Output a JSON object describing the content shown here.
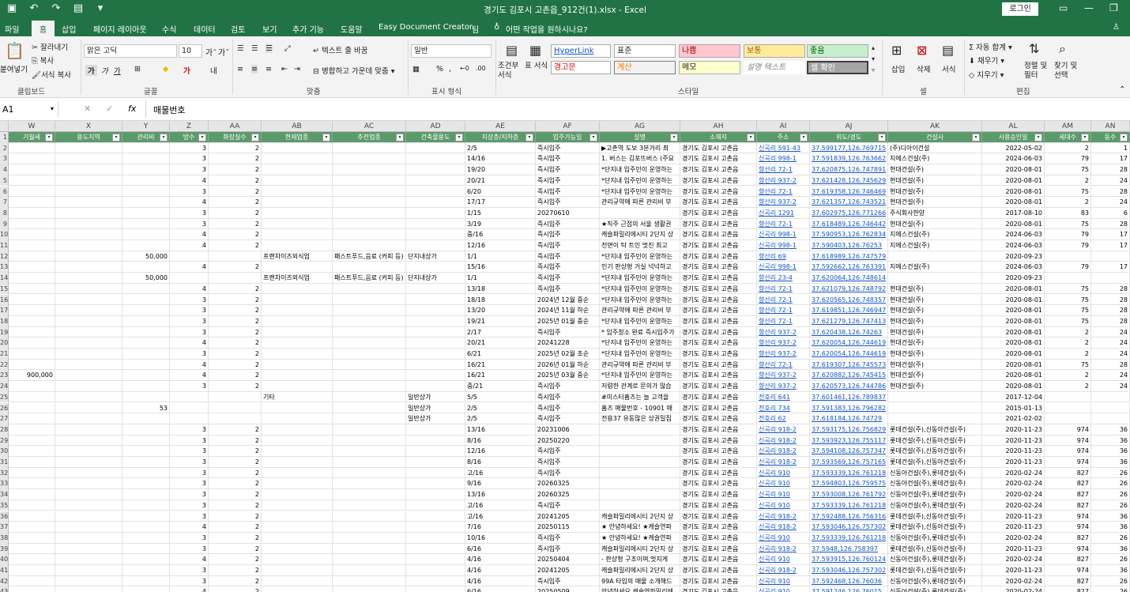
{
  "window": {
    "title": "경기도 김포시 고촌읍_912건(1).xlsx  -  Excel",
    "login": "로그인"
  },
  "tabs": [
    "파일",
    "홈",
    "삽입",
    "페이지 레이아웃",
    "수식",
    "데이터",
    "검토",
    "보기",
    "추가 기능",
    "도움말",
    "Easy Document Creator",
    "팀"
  ],
  "tell_me": "어떤 작업을 원하시나요?",
  "ribbon": {
    "paste": "붙여넣기",
    "cut": "잘라내기",
    "copy": "복사",
    "format_painter": "서식 복사",
    "clipboard": "클립보드",
    "font_name": "맑은 고딕",
    "font_size": "10",
    "font_group": "글꼴",
    "wrap": "텍스트 줄 바꿈",
    "merge": "병합하고 가운데 맞춤",
    "align_group": "맞춤",
    "number_format": "일반",
    "number_group": "표시 형식",
    "cond_format": "조건부 서식",
    "table_format": "표 서식",
    "styles": [
      "HyperLink",
      "표준",
      "나쁨",
      "보통",
      "좋음",
      "경고문",
      "계산",
      "메모",
      "설명 텍스트",
      "셀 확인"
    ],
    "styles_group": "스타일",
    "insert": "삽입",
    "delete": "삭제",
    "format": "서식",
    "cells_group": "셀",
    "autosum": "자동 합계",
    "fill": "채우기",
    "clear": "지우기",
    "sort": "정렬 및 필터",
    "find": "찾기 및 선택",
    "edit_group": "편집"
  },
  "formula_bar": {
    "cell": "A1",
    "value": "매물번호"
  },
  "columns": [
    {
      "letter": "W",
      "header": "기월세"
    },
    {
      "letter": "X",
      "header": "용도지역"
    },
    {
      "letter": "Y",
      "header": "관리비"
    },
    {
      "letter": "Z",
      "header": "방수"
    },
    {
      "letter": "AA",
      "header": "화장실수"
    },
    {
      "letter": "AB",
      "header": "현재업종"
    },
    {
      "letter": "AC",
      "header": "추천업종"
    },
    {
      "letter": "AD",
      "header": "건축물용도"
    },
    {
      "letter": "AE",
      "header": "지상층/지하층"
    },
    {
      "letter": "AF",
      "header": "입주가능일"
    },
    {
      "letter": "AG",
      "header": "설명"
    },
    {
      "letter": "AH",
      "header": "소재지"
    },
    {
      "letter": "AI",
      "header": "주소"
    },
    {
      "letter": "AJ",
      "header": "위도/경도"
    },
    {
      "letter": "AK",
      "header": "건설사"
    },
    {
      "letter": "AL",
      "header": "사용승인일"
    },
    {
      "letter": "AM",
      "header": "세대수"
    },
    {
      "letter": "AN",
      "header": "동수"
    }
  ],
  "rows": [
    [
      "2",
      "",
      "",
      "",
      "3",
      "2",
      "",
      "",
      "",
      "2/5",
      "즉시입주",
      "▶고촌역 도보 3분거리 최",
      "경기도 김포시 고촌읍",
      "신곡리 591-43",
      "37.599177,126.769715",
      "(주)디아이건설",
      "2022-05-02",
      "2",
      "1"
    ],
    [
      "3",
      "",
      "",
      "",
      "3",
      "2",
      "",
      "",
      "",
      "14/16",
      "즉시입주",
      "1. 버스는 김포뜨버스 (주요",
      "경기도 김포시 고촌읍",
      "신곡리 998-1",
      "37.591839,126.763662",
      "지에스건설(주)",
      "2024-06-03",
      "79",
      "17"
    ],
    [
      "4",
      "",
      "",
      "",
      "3",
      "2",
      "",
      "",
      "",
      "19/20",
      "즉시입주",
      "*단지내 입주민이 운영하는",
      "경기도 김포시 고촌읍",
      "향산리 72-1",
      "37.620875,126.747891",
      "현대건설(주)",
      "2020-08-01",
      "75",
      "28"
    ],
    [
      "5",
      "",
      "",
      "",
      "4",
      "2",
      "",
      "",
      "",
      "20/21",
      "즉시입주",
      "*단지내 입주민이 운영하는",
      "경기도 김포시 고촌읍",
      "향산리 937-2",
      "37.621428,126.745629",
      "현대건설(주)",
      "2020-08-01",
      "2",
      "24"
    ],
    [
      "6",
      "",
      "",
      "",
      "3",
      "2",
      "",
      "",
      "",
      "6/20",
      "즉시입주",
      "*단지내 입주민이 운영하는",
      "경기도 김포시 고촌읍",
      "향산리 72-1",
      "37.619358,126.746469",
      "현대건설(주)",
      "2020-08-01",
      "75",
      "28"
    ],
    [
      "7",
      "",
      "",
      "",
      "4",
      "2",
      "",
      "",
      "",
      "17/17",
      "즉시입주",
      "관리규약에 따른 관리비 부",
      "경기도 김포시 고촌읍",
      "향산리 937-2",
      "37.621357,126.743521",
      "현대건설(주)",
      "2020-08-01",
      "2",
      "24"
    ],
    [
      "8",
      "",
      "",
      "",
      "3",
      "2",
      "",
      "",
      "",
      "1/15",
      "20270610",
      "",
      "경기도 김포시 고촌읍",
      "신곡리 1291",
      "37.602975,126.771266",
      "주식회사한양",
      "2017-08-10",
      "83",
      "6"
    ],
    [
      "9",
      "",
      "",
      "",
      "3",
      "2",
      "",
      "",
      "",
      "3/19",
      "즉시입주",
      "★직주 근접의 서울 생활권",
      "경기도 김포시 고촌읍",
      "향산리 72-1",
      "37.618489,126.746442",
      "현대건설(주)",
      "2020-08-01",
      "75",
      "28"
    ],
    [
      "10",
      "",
      "",
      "",
      "4",
      "2",
      "",
      "",
      "",
      "중/16",
      "즉시입주",
      "캐슬파밀리에시티 2단지 상",
      "경기도 김포시 고촌읍",
      "신곡리 998-1",
      "37.590953,126.762834",
      "지에스건설(주)",
      "2024-06-03",
      "79",
      "17"
    ],
    [
      "11",
      "",
      "",
      "",
      "4",
      "2",
      "",
      "",
      "",
      "12/16",
      "즉시입주",
      "전면이 탁 트인 멋진 최고",
      "경기도 김포시 고촌읍",
      "신곡리 998-1",
      "37.590403,126.76253",
      "지에스건설(주)",
      "2024-06-03",
      "79",
      "17"
    ],
    [
      "12",
      "",
      "",
      "50,000",
      "",
      "",
      "프랜차이즈외식업",
      "패스트푸드,음료 (커피 등)",
      "단지내상가",
      "1/1",
      "즉시입주",
      "*단지내 입주민이 운영하는",
      "경기도 김포시 고촌읍",
      "향산리 69",
      "37.618989,126.747579",
      "",
      "2020-09-23",
      "",
      ""
    ],
    [
      "13",
      "",
      "",
      "",
      "4",
      "2",
      "",
      "",
      "",
      "15/16",
      "즉시입주",
      "인기 판상형 거실 넉넉하고",
      "경기도 김포시 고촌읍",
      "신곡리 998-1",
      "37.592662,126.763391",
      "지에스건설(주)",
      "2024-06-03",
      "79",
      "17"
    ],
    [
      "14",
      "",
      "",
      "50,000",
      "",
      "",
      "프랜차이즈외식업",
      "패스트푸드,음료 (커피 등)",
      "단지내상가",
      "1/1",
      "즉시입주",
      "*단지내 입주민이 운영하는",
      "경기도 김포시 고촌읍",
      "향산리 23-4",
      "37.620064,126.748614",
      "",
      "2020-09-23",
      "",
      ""
    ],
    [
      "15",
      "",
      "",
      "",
      "4",
      "2",
      "",
      "",
      "",
      "13/18",
      "즉시입주",
      "*단지내 입주민이 운영하는",
      "경기도 김포시 고촌읍",
      "향산리 72-1",
      "37.621079,126.748792",
      "현대건설(주)",
      "2020-08-01",
      "75",
      "28"
    ],
    [
      "16",
      "",
      "",
      "",
      "3",
      "2",
      "",
      "",
      "",
      "18/18",
      "2024년 12월 중순",
      "*단지내 입주민이 운영하는",
      "경기도 김포시 고촌읍",
      "향산리 72-1",
      "37.620565,126.748357",
      "현대건설(주)",
      "2020-08-01",
      "75",
      "28"
    ],
    [
      "17",
      "",
      "",
      "",
      "3",
      "2",
      "",
      "",
      "",
      "13/20",
      "2024년 11월 하순",
      "관리규약에 따른 관리비 부",
      "경기도 김포시 고촌읍",
      "향산리 72-1",
      "37.619851,126.746947",
      "현대건설(주)",
      "2020-08-01",
      "75",
      "28"
    ],
    [
      "18",
      "",
      "",
      "",
      "3",
      "2",
      "",
      "",
      "",
      "19/21",
      "2025년 01월 중순",
      "*단지내 입주민이 운영하는",
      "경기도 김포시 고촌읍",
      "향산리 72-1",
      "37.621279,126.747413",
      "현대건설(주)",
      "2020-08-01",
      "75",
      "28"
    ],
    [
      "19",
      "",
      "",
      "",
      "3",
      "2",
      "",
      "",
      "",
      "2/17",
      "즉시입주",
      "* 입주청소 완료 즉시입주가",
      "경기도 김포시 고촌읍",
      "향산리 937-2",
      "37.620438,126.74263",
      "현대건설(주)",
      "2020-08-01",
      "2",
      "24"
    ],
    [
      "20",
      "",
      "",
      "",
      "4",
      "2",
      "",
      "",
      "",
      "20/21",
      "20241228",
      "*단지내 입주민이 운영하는",
      "경기도 김포시 고촌읍",
      "향산리 937-2",
      "37.620054,126.744619",
      "현대건설(주)",
      "2020-08-01",
      "2",
      "24"
    ],
    [
      "21",
      "",
      "",
      "",
      "3",
      "2",
      "",
      "",
      "",
      "6/21",
      "2025년 02월 초순",
      "*단지내 입주민이 운영하는",
      "경기도 김포시 고촌읍",
      "향산리 937-2",
      "37.620054,126.744619",
      "현대건설(주)",
      "2020-08-01",
      "2",
      "24"
    ],
    [
      "22",
      "",
      "",
      "",
      "4",
      "2",
      "",
      "",
      "",
      "16/21",
      "2026년 01월 하순",
      "관리규약에 따른 관리비 부",
      "경기도 김포시 고촌읍",
      "향산리 72-1",
      "37.619307,126.745573",
      "현대건설(주)",
      "2020-08-01",
      "75",
      "28"
    ],
    [
      "23",
      "900,000",
      "",
      "",
      "4",
      "2",
      "",
      "",
      "",
      "16/21",
      "2025년 03월 중순",
      "*단지내 입주민이 운영하는",
      "경기도 김포시 고촌읍",
      "향산리 937-2",
      "37.620882,126.745415",
      "현대건설(주)",
      "2020-08-01",
      "2",
      "24"
    ],
    [
      "24",
      "",
      "",
      "",
      "3",
      "2",
      "",
      "",
      "",
      "중/21",
      "즉시입주",
      "저렴한 관계로 문의가 많습",
      "경기도 김포시 고촌읍",
      "향산리 937-2",
      "37.620573,126.744786",
      "현대건설(주)",
      "2020-08-01",
      "2",
      "24"
    ],
    [
      "25",
      "",
      "",
      "",
      "",
      "",
      "기타",
      "",
      "일반상가",
      "5/5",
      "즉시입주",
      "#미스터홈즈는 늘 고객을",
      "경기도 김포시 고촌읍",
      "전호리 641",
      "37.601461,126.789837",
      "",
      "2017-12-04",
      "",
      ""
    ],
    [
      "26",
      "",
      "",
      "53",
      "",
      "",
      "",
      "",
      "일반상가",
      "2/5",
      "즉시입주",
      "홈즈 매물번호 - 10901 매",
      "경기도 김포시 고촌읍",
      "전호리 734",
      "37.591383,126.796282",
      "",
      "2015-01-13",
      "",
      ""
    ],
    [
      "27",
      "",
      "",
      "",
      "",
      "",
      "",
      "",
      "일반상가",
      "2/5",
      "즉시입주",
      "전용37 유동많은 상권밀집",
      "경기도 김포시 고촌읍",
      "전호리 62",
      "37.618184,126.74729",
      "",
      "2021-02-02",
      "",
      ""
    ],
    [
      "28",
      "",
      "",
      "",
      "3",
      "2",
      "",
      "",
      "",
      "13/16",
      "20231006",
      "",
      "경기도 김포시 고촌읍",
      "신곡리 918-2",
      "37.593175,126.756829",
      "롯데건설(주),신동아건설(주)",
      "2020-11-23",
      "974",
      "36"
    ],
    [
      "29",
      "",
      "",
      "",
      "3",
      "2",
      "",
      "",
      "",
      "8/16",
      "20250220",
      "",
      "경기도 김포시 고촌읍",
      "신곡리 918-2",
      "37.593923,126.755117",
      "롯데건설(주),신동아건설(주)",
      "2020-11-23",
      "974",
      "36"
    ],
    [
      "30",
      "",
      "",
      "",
      "3",
      "2",
      "",
      "",
      "",
      "12/16",
      "즉시입주",
      "",
      "경기도 김포시 고촌읍",
      "신곡리 918-2",
      "37.594108,126.757347",
      "롯데건설(주),신동아건설(주)",
      "2020-11-23",
      "974",
      "36"
    ],
    [
      "31",
      "",
      "",
      "",
      "3",
      "2",
      "",
      "",
      "",
      "8/16",
      "즉시입주",
      "",
      "경기도 김포시 고촌읍",
      "신곡리 918-2",
      "37.593569,126.757165",
      "롯데건설(주),신동아건설(주)",
      "2020-11-23",
      "974",
      "36"
    ],
    [
      "32",
      "",
      "",
      "",
      "3",
      "2",
      "",
      "",
      "",
      "고/16",
      "즉시입주",
      "",
      "경기도 김포시 고촌읍",
      "신곡리 910",
      "37.593339,126.761218",
      "신동아건설(주),롯데건설(주)",
      "2020-02-24",
      "827",
      "26"
    ],
    [
      "33",
      "",
      "",
      "",
      "3",
      "2",
      "",
      "",
      "",
      "9/16",
      "20260325",
      "",
      "경기도 김포시 고촌읍",
      "신곡리 910",
      "37.594803,126.759575",
      "신동아건설(주),롯데건설(주)",
      "2020-02-24",
      "827",
      "26"
    ],
    [
      "34",
      "",
      "",
      "",
      "3",
      "2",
      "",
      "",
      "",
      "13/16",
      "20260325",
      "",
      "경기도 김포시 고촌읍",
      "신곡리 910",
      "37.593008,126.761792",
      "신동아건설(주),롯데건설(주)",
      "2020-02-24",
      "827",
      "26"
    ],
    [
      "35",
      "",
      "",
      "",
      "3",
      "2",
      "",
      "",
      "",
      "고/16",
      "즉시입주",
      "",
      "경기도 김포시 고촌읍",
      "신곡리 910",
      "37.593339,126.761218",
      "신동아건설(주),롯데건설(주)",
      "2020-02-24",
      "827",
      "26"
    ],
    [
      "36",
      "",
      "",
      "",
      "3",
      "2",
      "",
      "",
      "",
      "고/16",
      "20241205",
      "캐슬파밀리에시티 2단지 상",
      "경기도 김포시 고촌읍",
      "신곡리 918-2",
      "37.592488,126.756316",
      "롯데건설(주),신동아건설(주)",
      "2020-11-23",
      "974",
      "36"
    ],
    [
      "37",
      "",
      "",
      "",
      "4",
      "2",
      "",
      "",
      "",
      "7/16",
      "20250115",
      "★ 안녕하세요! ★캐슬연파",
      "경기도 김포시 고촌읍",
      "신곡리 918-2",
      "37.593046,126.757302",
      "롯데건설(주),신동아건설(주)",
      "2020-11-23",
      "974",
      "36"
    ],
    [
      "38",
      "",
      "",
      "",
      "3",
      "2",
      "",
      "",
      "",
      "10/16",
      "즉시입주",
      "★ 안녕하세요! ★캐슬연파",
      "경기도 김포시 고촌읍",
      "신곡리 910",
      "37.593339,126.761218",
      "신동아건설(주),롯데건설(주)",
      "2020-02-24",
      "827",
      "26"
    ],
    [
      "39",
      "",
      "",
      "",
      "3",
      "2",
      "",
      "",
      "",
      "6/16",
      "즉시입주",
      "캐슬파밀리에시티 2단지 상",
      "경기도 김포시 고촌읍",
      "신곡리 918-2",
      "37.5948,126.758397",
      "롯데건설(주),신동아건설(주)",
      "2020-11-23",
      "974",
      "36"
    ],
    [
      "40",
      "",
      "",
      "",
      "4",
      "2",
      "",
      "",
      "",
      "4/16",
      "20250404",
      "- 판상형 구조이며,멋지게",
      "경기도 김포시 고촌읍",
      "신곡리 910",
      "37.593915,126.760124",
      "신동아건설(주),롯데건설(주)",
      "2020-02-24",
      "827",
      "26"
    ],
    [
      "41",
      "",
      "",
      "",
      "3",
      "2",
      "",
      "",
      "",
      "4/16",
      "20241205",
      "캐슬파밀리에시티 2단지 상",
      "경기도 김포시 고촌읍",
      "신곡리 918-2",
      "37.593046,126.757302",
      "롯데건설(주),신동아건설(주)",
      "2020-11-23",
      "974",
      "36"
    ],
    [
      "42",
      "",
      "",
      "",
      "3",
      "2",
      "",
      "",
      "",
      "4/16",
      "즉시입주",
      "99A 타입의 매물 소개해드",
      "경기도 김포시 고촌읍",
      "신곡리 910",
      "37.592468,126.76036",
      "신동아건설(주),롯데건설(주)",
      "2020-02-24",
      "827",
      "26"
    ],
    [
      "43",
      "",
      "",
      "",
      "4",
      "2",
      "",
      "",
      "",
      "6/16",
      "20250509",
      "안녕하세요 캐슬연파밀리에",
      "경기도 김포시 고촌읍",
      "신곡리 910",
      "37.591246,126.76015",
      "신동아건설(주),롯데건설(주)",
      "2020-02-24",
      "827",
      "26"
    ]
  ]
}
